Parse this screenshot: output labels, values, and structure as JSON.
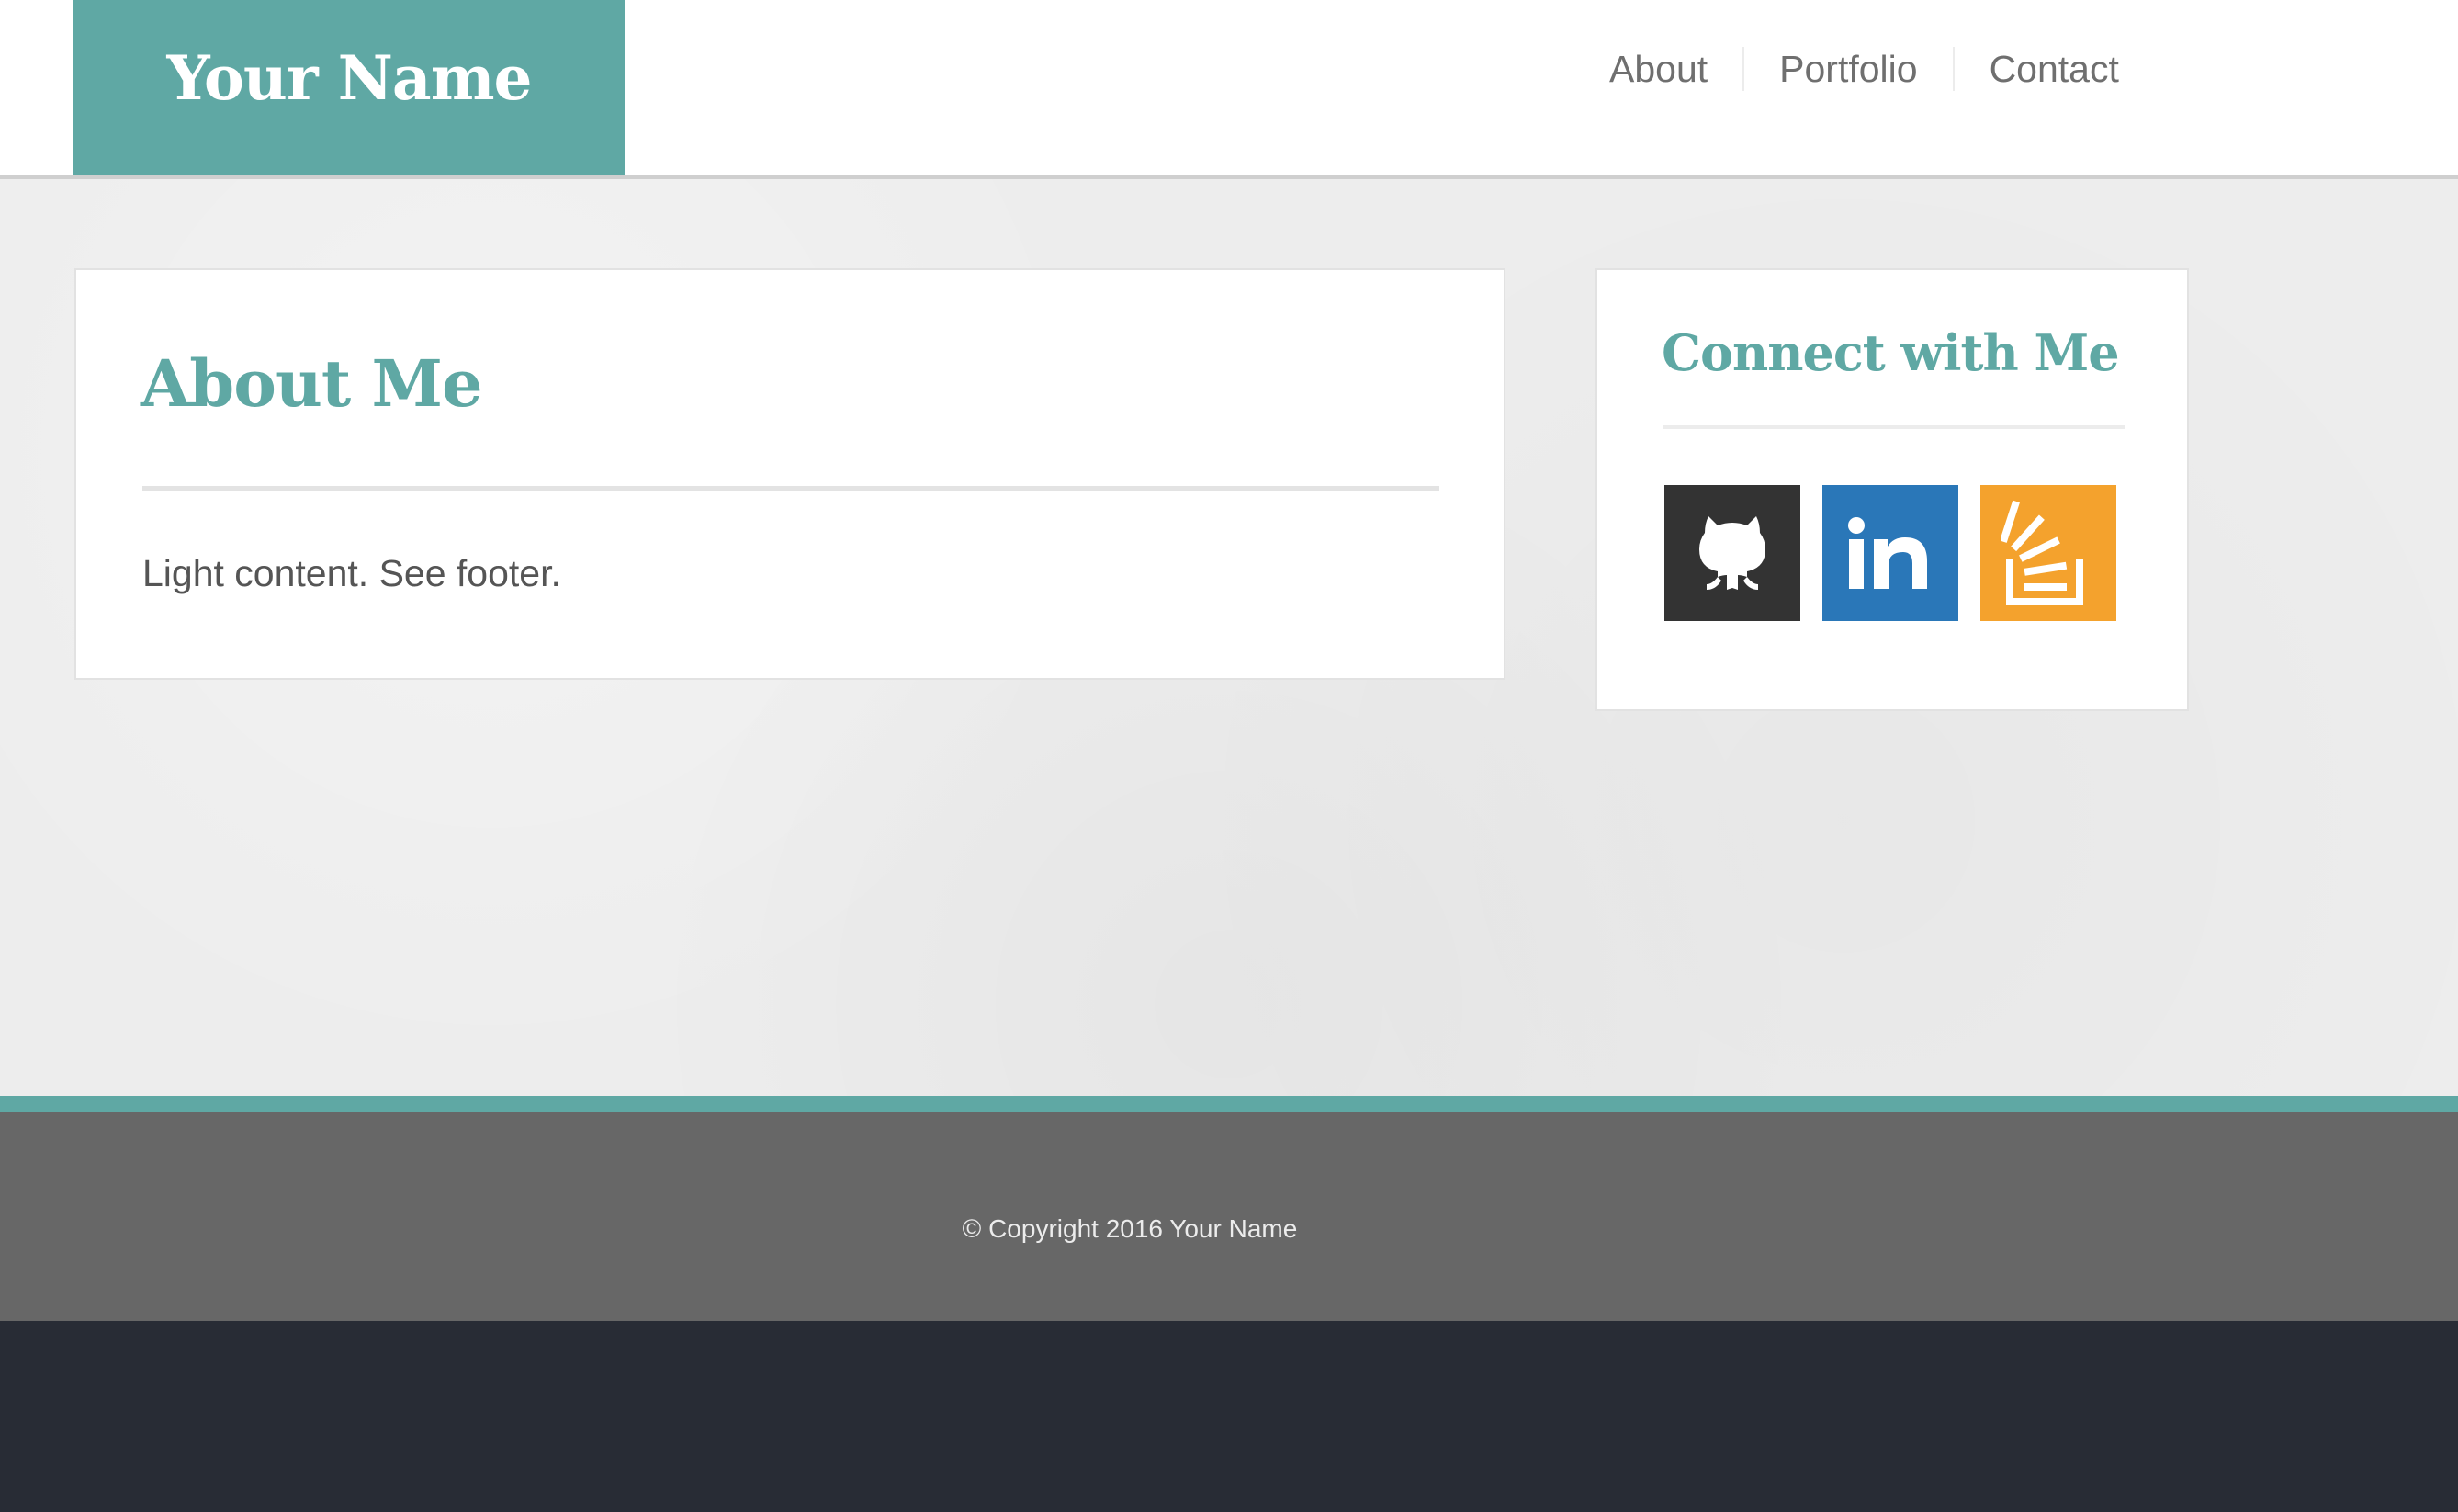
{
  "header": {
    "brand": "Your Name",
    "nav": [
      {
        "label": "About"
      },
      {
        "label": "Portfolio"
      },
      {
        "label": "Contact"
      }
    ]
  },
  "about": {
    "title": "About Me",
    "text": "Light content. See footer."
  },
  "connect": {
    "title": "Connect with Me",
    "social": [
      {
        "name": "github-icon",
        "color": "#333333"
      },
      {
        "name": "linkedin-icon",
        "color": "#2a77b8"
      },
      {
        "name": "stackoverflow-icon",
        "color": "#f4a22d"
      }
    ]
  },
  "footer": {
    "copyright": "© Copyright 2016 Your Name"
  },
  "colors": {
    "accent": "#5fa8a4",
    "footer_bg": "#676767",
    "page_bottom": "#282c35"
  }
}
